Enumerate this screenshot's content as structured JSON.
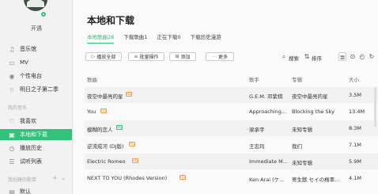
{
  "sidebar": {
    "username": "开遇",
    "nav_top": [
      {
        "label": "音乐馆",
        "icon": "music-hall-icon"
      },
      {
        "label": "MV",
        "icon": "mv-icon"
      },
      {
        "label": "个性电台",
        "icon": "radio-icon"
      },
      {
        "label": "明日之子第二季",
        "icon": "star-icon"
      }
    ],
    "section_my_music": "我的音乐",
    "nav_my": [
      {
        "label": "我喜欢",
        "icon": "heart-icon"
      },
      {
        "label": "本地和下载",
        "icon": "download-icon",
        "active": true
      },
      {
        "label": "播放历史",
        "icon": "history-icon"
      },
      {
        "label": "试听列表",
        "icon": "list-icon"
      }
    ],
    "section_created": "我创建的歌单",
    "nav_bottom": [
      {
        "label": "默认",
        "icon": "folder-icon"
      }
    ]
  },
  "main": {
    "title": "本地和下载",
    "tabs": [
      {
        "label": "本地歌曲28",
        "active": true
      },
      {
        "label": "下载歌曲1"
      },
      {
        "label": "正在下载0"
      },
      {
        "label": "下载历史漫游"
      }
    ],
    "toolbar": {
      "play_all": "播放全部",
      "batch": "批量操作",
      "add": "添加",
      "more": "更多",
      "search": "搜索",
      "sort": "排序"
    },
    "columns": [
      "歌曲",
      "歌手",
      "专辑",
      "大小"
    ],
    "rows": [
      {
        "song": "夜空中最亮的星",
        "badge": "orange",
        "artist": "G.E.M. 邓紫棋",
        "album": "夜空中最亮的星",
        "size": "3.5M"
      },
      {
        "song": "You",
        "badge": "orange",
        "artist": "Approaching...",
        "album": "Blocking the Sky",
        "size": "13.4M"
      },
      {
        "song": "模糊的恋人",
        "badge": "green",
        "artist": "梁承宇",
        "album": "未知专辑",
        "size": "8.3M"
      },
      {
        "song": "逆流成河 (DJ版)",
        "badge": "orange",
        "artist": "王忠玛",
        "album": "我们",
        "size": "7.1M"
      },
      {
        "song": "Electric Romeo",
        "badge": "orange",
        "artist": "Immediate M...",
        "album": "未知专辑",
        "size": "5.9M"
      },
      {
        "song": "NEXT TO YOU (Rhodes Version)",
        "badge": "orange",
        "artist": "Ken Arai (ケ...",
        "album": "寄生獣 セイの格率...",
        "size": "4.1M"
      }
    ]
  },
  "colors": {
    "accent": "#31c27c",
    "badge_orange": "#f49e45"
  }
}
